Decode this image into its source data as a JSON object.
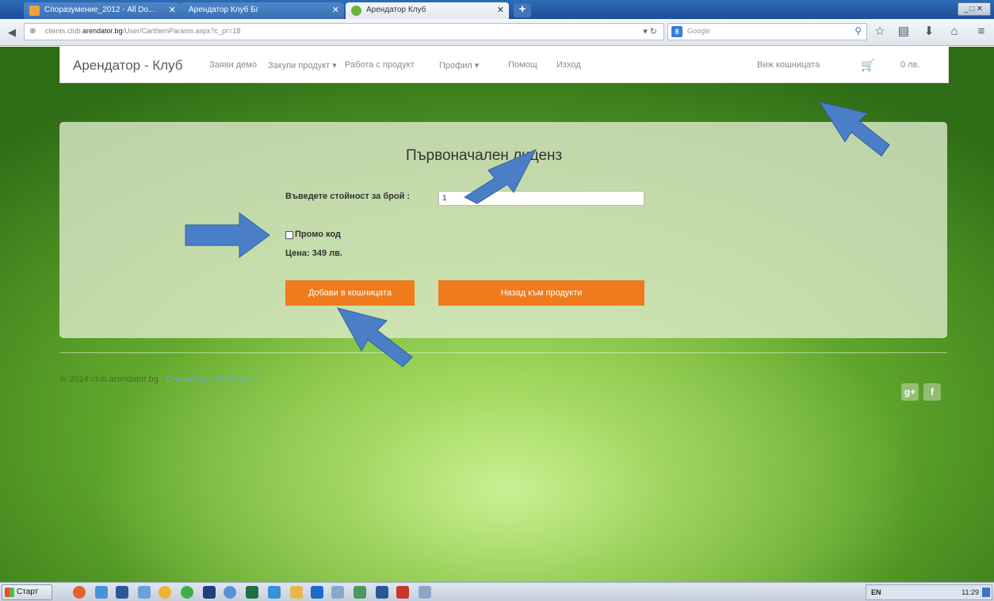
{
  "browser": {
    "tabs": [
      {
        "label": "Споразумение_2012 - All Do...",
        "state": "inactive"
      },
      {
        "label": "Арендатор Клуб Бг",
        "state": "inactive"
      },
      {
        "label": "Арендатор Клуб",
        "state": "active"
      }
    ],
    "url_domain": "arendator.bg",
    "url_prefix": "clients.club.",
    "url_path": "/User/CartItemParams.aspx?c_pr=18",
    "search_placeholder": "Google"
  },
  "site": {
    "brand": "Арендатор - Клуб",
    "nav": {
      "demo": "Заяви демо",
      "buy": "Закупи продукт ▾",
      "work": "Работа с продукт",
      "profile": "Профил ▾",
      "help": "Помощ",
      "logout": "Изход",
      "view_cart": "Виж кошницата",
      "cart_total": "0 лв."
    }
  },
  "form": {
    "title": "Първоначален лиценз",
    "quantity_label": "Въведете стойност за брой :",
    "quantity_value": "1",
    "promo_label": "Промо код",
    "price": "Цена: 349 лв.",
    "add_to_cart": "Добави в кошницата",
    "back_to_products": "Назад към продукти"
  },
  "footer": {
    "copyright": "© 2014 club.arendator.bg",
    "created_by": " - Created by: VS Consult",
    "social": [
      "g+",
      "f"
    ]
  },
  "taskbar": {
    "start_label": "Старт",
    "lang": "EN",
    "clock": "11:29"
  },
  "colors": {
    "accent_orange": "#ef7b1c",
    "arrow_blue": "#4a7fc8",
    "background_green": "#5ea42a"
  }
}
